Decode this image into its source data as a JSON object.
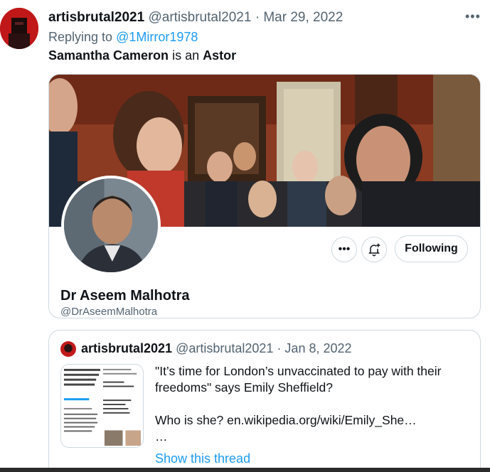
{
  "tweet": {
    "author_name": "artisbrutal2021",
    "author_meta": "@artisbrutal2021 · Mar 29, 2022",
    "reply_prefix": "Replying to ",
    "reply_handle": "@1Mirror1978",
    "text_part1": "Samantha Cameron",
    "text_part2": " is an ",
    "text_part3": "Astor",
    "more_icon": "more-horizontal-icon"
  },
  "profile_card": {
    "name": "Dr Aseem Malhotra",
    "handle": "@DrAseemMalhotra",
    "follow_label": "Following",
    "more_icon": "more-horizontal-icon",
    "notify_icon": "bell-plus-icon"
  },
  "quoted_tweet": {
    "author_name": "artisbrutal2021",
    "author_meta": "@artisbrutal2021 · Jan 8, 2022",
    "text": "\"It’s time for London’s unvaccinated to pay with their freedoms\" says Emily Sheffield?\n\nWho is she? en.wikipedia.org/wiki/Emily_She…\n…",
    "show_thread_label": "Show this thread"
  },
  "colors": {
    "link": "#1d9bf0",
    "muted": "#536471",
    "border": "#cfd9de",
    "text": "#0f1419"
  }
}
